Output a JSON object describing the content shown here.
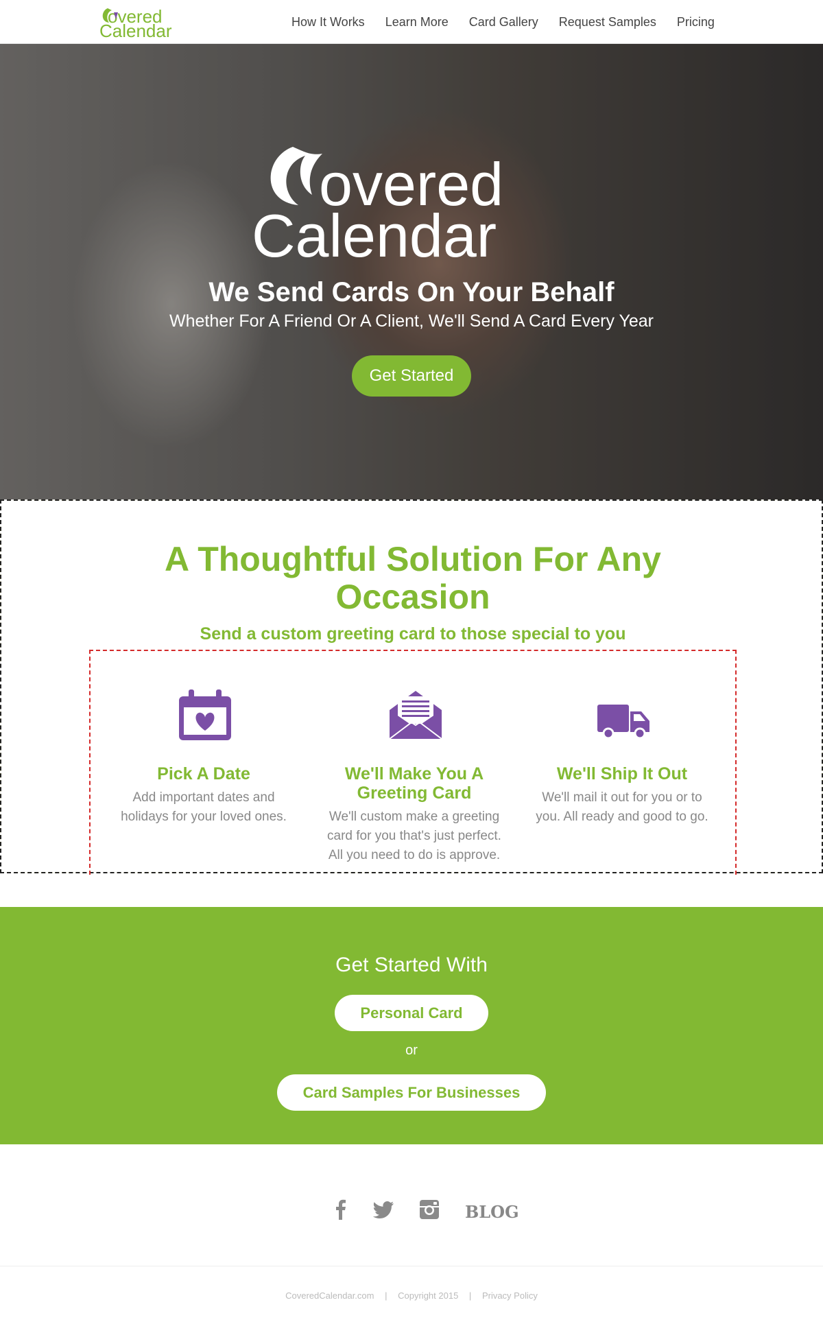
{
  "nav": {
    "logo_text_top": "overed",
    "logo_text_bottom": "Calendar",
    "links": [
      "How It Works",
      "Learn More",
      "Card Gallery",
      "Request Samples",
      "Pricing"
    ]
  },
  "hero": {
    "logo_text_top": "overed",
    "logo_text_bottom": "Calendar",
    "title": "We Send Cards On Your Behalf",
    "subtitle": "Whether For A Friend Or A Client, We'll Send A Card Every Year",
    "cta_label": "Get Started"
  },
  "solution": {
    "title_line1": "A Thoughtful Solution For Any",
    "title_line2": "Occasion",
    "subtitle": "Send a custom greeting card to those special to you",
    "features": [
      {
        "icon": "calendar-heart-icon",
        "title_line1": "Pick A Date",
        "title_line2": "",
        "desc": [
          "Add important dates and",
          "holidays for your loved ones."
        ]
      },
      {
        "icon": "envelope-letter-icon",
        "title_line1": "We'll Make You A",
        "title_line2": "Greeting Card",
        "desc": [
          "We'll custom make a greeting",
          "card for you that's just perfect.",
          "All you need to do is approve."
        ]
      },
      {
        "icon": "truck-icon",
        "title_line1": "We'll Ship It Out",
        "title_line2": "",
        "desc": [
          "We'll mail it out for you or to",
          "you. All ready and good to go."
        ]
      }
    ]
  },
  "get_started": {
    "title": "Get Started With",
    "personal_label": "Personal Card",
    "or_text": "or",
    "business_label": "Card Samples For Businesses"
  },
  "social": {
    "icons": [
      "facebook-icon",
      "twitter-icon",
      "instagram-icon"
    ],
    "blog_label": "BLOG"
  },
  "footer": {
    "site": "CoveredCalendar.com",
    "copyright": "Copyright 2015",
    "privacy": "Privacy Policy"
  },
  "colors": {
    "brand_green": "#82b933",
    "brand_purple": "#7b4fa6",
    "text_gray": "#888888"
  }
}
